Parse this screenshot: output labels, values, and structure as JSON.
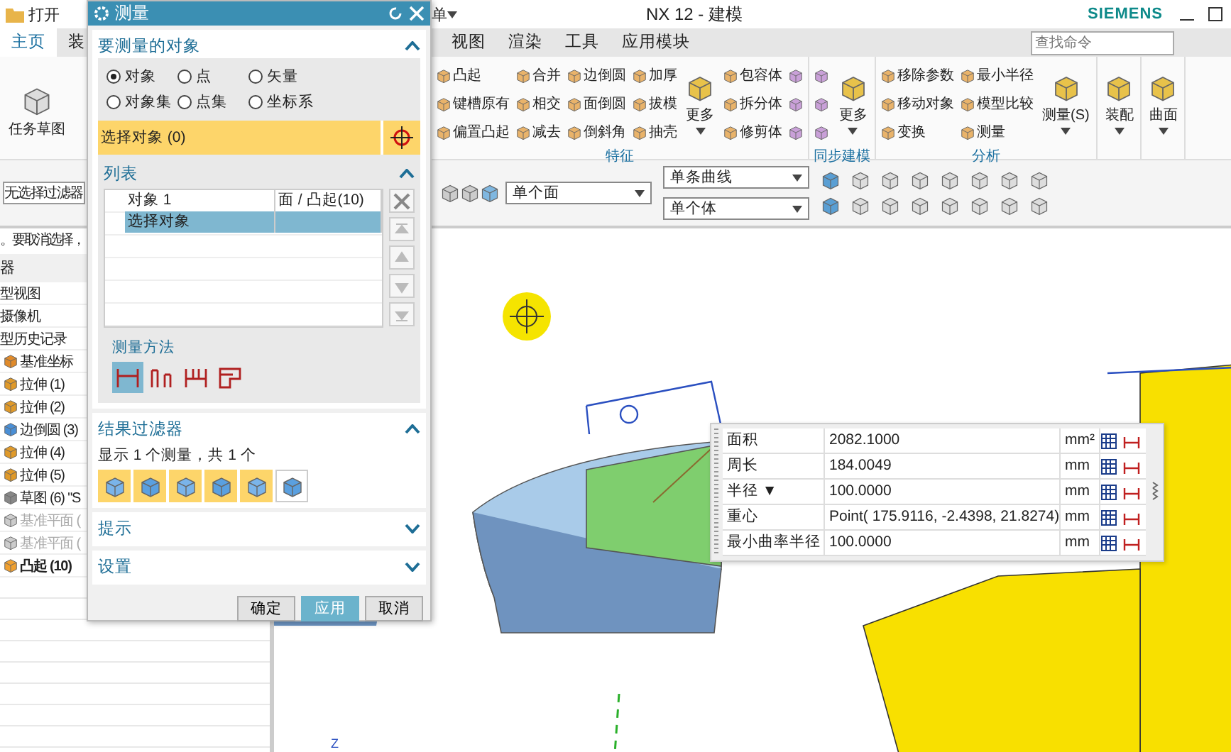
{
  "title_bar": {
    "quick_access": "打开",
    "menu_cut": "单",
    "title": "NX 12 - 建模",
    "brand": "SIEMENS"
  },
  "tabs": [
    {
      "label": "主页",
      "selected": true
    },
    {
      "label": "装",
      "selected": false
    },
    {
      "label": "视图",
      "selected": false
    },
    {
      "label": "渲染",
      "selected": false
    },
    {
      "label": "工具",
      "selected": false
    },
    {
      "label": "应用模块",
      "selected": false
    }
  ],
  "search": {
    "placeholder": "查找命令"
  },
  "ribbon_left": [
    "任务草图"
  ],
  "ribbon_groups": [
    {
      "label": "特征",
      "items": [
        {
          "kind": "small",
          "label": "凸起"
        },
        {
          "kind": "small",
          "label": "键槽原有"
        },
        {
          "kind": "small",
          "label": "偏置凸起"
        },
        {
          "kind": "small",
          "label": "合并"
        },
        {
          "kind": "small",
          "label": "相交"
        },
        {
          "kind": "small",
          "label": "减去"
        },
        {
          "kind": "small",
          "label": "边倒圆"
        },
        {
          "kind": "small",
          "label": "面倒圆"
        },
        {
          "kind": "small",
          "label": "倒斜角"
        },
        {
          "kind": "small",
          "label": "加厚"
        },
        {
          "kind": "small",
          "label": "拔模"
        },
        {
          "kind": "small",
          "label": "抽壳"
        },
        {
          "kind": "large",
          "label": "更多"
        },
        {
          "kind": "small",
          "label": "包容体"
        },
        {
          "kind": "small",
          "label": "拆分体"
        },
        {
          "kind": "small",
          "label": "修剪体"
        },
        {
          "kind": "icon"
        },
        {
          "kind": "icon"
        },
        {
          "kind": "icon"
        }
      ]
    },
    {
      "label": "同步建模",
      "items": [
        {
          "kind": "icon"
        },
        {
          "kind": "icon"
        },
        {
          "kind": "icon"
        },
        {
          "kind": "large",
          "label": "更多"
        }
      ]
    },
    {
      "label": "分析",
      "items": [
        {
          "kind": "small",
          "label": "移除参数"
        },
        {
          "kind": "small",
          "label": "移动对象"
        },
        {
          "kind": "small",
          "label": "变换"
        },
        {
          "kind": "small",
          "label": "最小半径"
        },
        {
          "kind": "small",
          "label": "模型比较"
        },
        {
          "kind": "small",
          "label": "测量"
        },
        {
          "kind": "large",
          "label": "测量(S)"
        }
      ]
    },
    {
      "items": [
        {
          "kind": "large",
          "label": "装配"
        }
      ]
    },
    {
      "items": [
        {
          "kind": "large",
          "label": "曲面"
        }
      ]
    }
  ],
  "toolbar": {
    "filter": "无选择过滤器",
    "face_rule": "单个面",
    "curve_rule": "单条曲线",
    "body_rule": "单个体"
  },
  "cue_line": "。要取消选择，",
  "navigator": {
    "title": "器",
    "items": [
      {
        "label": "型视图"
      },
      {
        "label": "摄像机"
      },
      {
        "label": "型历史记录",
        "children": [
          {
            "kind": "csys",
            "label": "基准坐标",
            "disabled": false,
            "current": false
          },
          {
            "kind": "extrude",
            "label": "拉伸 (1)",
            "disabled": false,
            "current": false
          },
          {
            "kind": "extrude",
            "label": "拉伸 (2)",
            "disabled": false,
            "current": false
          },
          {
            "kind": "blend",
            "label": "边倒圆 (3)",
            "disabled": false,
            "current": false
          },
          {
            "kind": "extrude",
            "label": "拉伸 (4)",
            "disabled": false,
            "current": false
          },
          {
            "kind": "extrude",
            "label": "拉伸 (5)",
            "disabled": false,
            "current": false
          },
          {
            "kind": "sketch",
            "label": "草图 (6) \"S",
            "disabled": false,
            "current": false
          },
          {
            "kind": "plane",
            "label": "基准平面 (",
            "disabled": true,
            "current": false
          },
          {
            "kind": "plane",
            "label": "基准平面 (",
            "disabled": true,
            "current": false
          },
          {
            "kind": "boss",
            "label": "凸起 (10)",
            "disabled": false,
            "current": true
          }
        ]
      }
    ]
  },
  "dialog": {
    "title": "测量",
    "sections": [
      {
        "title": "要测量的对象",
        "expanded": true
      },
      {
        "title": "列表",
        "expanded": true
      },
      {
        "title": "结果过滤器",
        "expanded": true
      },
      {
        "title": "提示",
        "expanded": false
      },
      {
        "title": "设置",
        "expanded": false
      }
    ],
    "object_types": [
      {
        "label": "对象",
        "selected": true
      },
      {
        "label": "点",
        "selected": false
      },
      {
        "label": "矢量",
        "selected": false
      },
      {
        "label": "对象集",
        "selected": false
      },
      {
        "label": "点集",
        "selected": false
      },
      {
        "label": "坐标系",
        "selected": false
      }
    ],
    "select_object": "选择对象 (0)",
    "list_rows": [
      {
        "column_1": "对象 1",
        "column_2": "面 / 凸起(10)",
        "selected": false
      },
      {
        "column_1": "选择对象",
        "selected": true
      }
    ],
    "method_title": "测量方法",
    "methods": [
      {
        "selected": true
      },
      {
        "selected": false
      },
      {
        "selected": false
      },
      {
        "selected": false
      }
    ],
    "filter_summary": "显示 1 个测量，共 1 个",
    "filters": [
      {
        "on": true
      },
      {
        "on": true
      },
      {
        "on": true
      },
      {
        "on": true
      },
      {
        "on": true
      },
      {
        "on": false
      }
    ],
    "buttons": [
      {
        "label": "确定",
        "default": false
      },
      {
        "label": "应用",
        "default": true
      },
      {
        "label": "取消",
        "default": false
      }
    ]
  },
  "results": [
    {
      "label": "面积",
      "value": "2082.1000",
      "unit": "mm²"
    },
    {
      "label": "周长",
      "value": "184.0049",
      "unit": "mm"
    },
    {
      "label": "半径",
      "marker": "▼",
      "value": "100.0000",
      "unit": "mm"
    },
    {
      "label": "重心",
      "value": "Point( 175.9116, -2.4398, 21.8274)",
      "unit": "mm"
    },
    {
      "label": "最小曲率半径",
      "value": "100.0000",
      "unit": "mm"
    }
  ],
  "axis_label": "Z"
}
